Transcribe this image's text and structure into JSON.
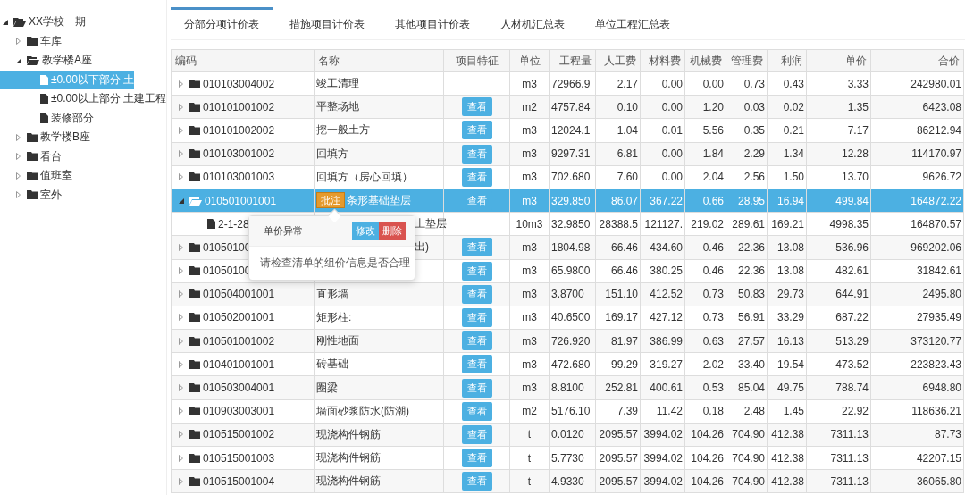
{
  "tree": [
    {
      "label": "XX学校一期",
      "kind": "folder",
      "expanded": true,
      "selected": false,
      "children": [
        {
          "label": "车库",
          "kind": "folder",
          "expanded": false,
          "selected": false
        },
        {
          "label": "教学楼A座",
          "kind": "folder",
          "expanded": true,
          "selected": false,
          "children": [
            {
              "label": "±0.00以下部分 土",
              "kind": "file",
              "selected": true
            },
            {
              "label": "±0.00以上部分 土建工程",
              "kind": "file",
              "selected": false
            },
            {
              "label": "装修部分",
              "kind": "file",
              "selected": false
            }
          ]
        },
        {
          "label": "教学楼B座",
          "kind": "folder",
          "expanded": false,
          "selected": false
        },
        {
          "label": "看台",
          "kind": "folder",
          "expanded": false,
          "selected": false
        },
        {
          "label": "值班室",
          "kind": "folder",
          "expanded": false,
          "selected": false
        },
        {
          "label": "室外",
          "kind": "folder",
          "expanded": false,
          "selected": false
        }
      ]
    }
  ],
  "tabs": [
    {
      "label": "分部分项计价表",
      "selected": true
    },
    {
      "label": "措施项目计价表",
      "selected": false
    },
    {
      "label": "其他项目计价表",
      "selected": false
    },
    {
      "label": "人材机汇总表",
      "selected": false
    },
    {
      "label": "单位工程汇总表",
      "selected": false
    }
  ],
  "table": {
    "columns": [
      "编码",
      "名称",
      "项目特征",
      "单位",
      "工程量",
      "人工费",
      "材料费",
      "机械费",
      "管理费",
      "利润",
      "单价",
      "合价"
    ],
    "rows": [
      {
        "code": "010103004002",
        "kind": "folder",
        "expanded": false,
        "selected": false,
        "name": "竣工清理",
        "unit": "m3",
        "values": [
          "72966.9",
          "2.17",
          "0.00",
          "0.00",
          "0.73",
          "0.43",
          "3.33",
          "242980.01"
        ]
      },
      {
        "code": "010101001002",
        "kind": "folder",
        "expanded": false,
        "selected": false,
        "name": "平整场地",
        "feature": "查看",
        "unit": "m2",
        "values": [
          "4757.84",
          "0.10",
          "0.00",
          "1.20",
          "0.03",
          "0.02",
          "1.35",
          "6423.08"
        ]
      },
      {
        "code": "010101002002",
        "kind": "folder",
        "expanded": false,
        "selected": false,
        "name": "挖一般土方",
        "feature": "查看",
        "unit": "m3",
        "values": [
          "12024.1",
          "1.04",
          "0.01",
          "5.56",
          "0.35",
          "0.21",
          "7.17",
          "86212.94"
        ]
      },
      {
        "code": "010103001002",
        "kind": "folder",
        "expanded": false,
        "selected": false,
        "name": "回填方",
        "feature": "查看",
        "unit": "m3",
        "values": [
          "9297.31",
          "6.81",
          "0.00",
          "1.84",
          "2.29",
          "1.34",
          "12.28",
          "114170.97"
        ]
      },
      {
        "code": "010103001003",
        "kind": "folder",
        "expanded": false,
        "selected": false,
        "name": "回填方（房心回填）",
        "feature": "查看",
        "unit": "m3",
        "values": [
          "702.680",
          "7.60",
          "0.00",
          "2.04",
          "2.56",
          "1.50",
          "13.70",
          "9626.72"
        ]
      },
      {
        "code": "010501001001",
        "kind": "folder",
        "expanded": true,
        "selected": true,
        "note": "批注",
        "name": "条形基础垫层",
        "feature": "查看",
        "unit": "m3",
        "values": [
          "329.850",
          "86.07",
          "367.22",
          "0.66",
          "28.95",
          "16.94",
          "499.84",
          "164872.22"
        ],
        "children": [
          {
            "code": "2-1-28",
            "kind": "file",
            "selected": false,
            "name": "土垫层",
            "unit": "10m3",
            "values": [
              "32.9850",
              "28388.5",
              "121127.",
              "219.02",
              "289.61",
              "169.21",
              "4998.35",
              "164870.57"
            ]
          }
        ]
      },
      {
        "code": "01050100",
        "kind": "folder",
        "expanded": false,
        "selected": false,
        "name": "出)",
        "feature": "查看",
        "unit": "m3",
        "values": [
          "1804.98",
          "66.46",
          "434.60",
          "0.46",
          "22.36",
          "13.08",
          "536.96",
          "969202.06"
        ]
      },
      {
        "code": "01050100",
        "kind": "folder",
        "expanded": false,
        "selected": false,
        "feature": "查看",
        "unit": "m3",
        "values": [
          "65.9800",
          "66.46",
          "380.25",
          "0.46",
          "22.36",
          "13.08",
          "482.61",
          "31842.61"
        ]
      },
      {
        "code": "010504001001",
        "kind": "folder",
        "expanded": false,
        "selected": false,
        "name": "直形墙",
        "feature": "查看",
        "unit": "m3",
        "values": [
          "3.8700",
          "151.10",
          "412.52",
          "0.73",
          "50.83",
          "29.73",
          "644.91",
          "2495.80"
        ]
      },
      {
        "code": "010502001001",
        "kind": "folder",
        "expanded": false,
        "selected": false,
        "name": "矩形柱:",
        "feature": "查看",
        "unit": "m3",
        "values": [
          "40.6500",
          "169.17",
          "427.12",
          "0.73",
          "56.91",
          "33.29",
          "687.22",
          "27935.49"
        ]
      },
      {
        "code": "010501001002",
        "kind": "folder",
        "expanded": false,
        "selected": false,
        "name": "刚性地面",
        "feature": "查看",
        "unit": "m3",
        "values": [
          "726.920",
          "81.97",
          "386.99",
          "0.63",
          "27.57",
          "16.13",
          "513.29",
          "373120.77"
        ]
      },
      {
        "code": "010401001001",
        "kind": "folder",
        "expanded": false,
        "selected": false,
        "name": "砖基础",
        "feature": "查看",
        "unit": "m3",
        "values": [
          "472.680",
          "99.29",
          "319.27",
          "2.02",
          "33.40",
          "19.54",
          "473.52",
          "223823.43"
        ]
      },
      {
        "code": "010503004001",
        "kind": "folder",
        "expanded": false,
        "selected": false,
        "name": "圈梁",
        "feature": "查看",
        "unit": "m3",
        "values": [
          "8.8100",
          "252.81",
          "400.61",
          "0.53",
          "85.04",
          "49.75",
          "788.74",
          "6948.80"
        ]
      },
      {
        "code": "010903003001",
        "kind": "folder",
        "expanded": false,
        "selected": false,
        "name": "墙面砂浆防水(防潮)",
        "feature": "查看",
        "unit": "m2",
        "values": [
          "5176.10",
          "7.39",
          "11.42",
          "0.18",
          "2.48",
          "1.45",
          "22.92",
          "118636.21"
        ]
      },
      {
        "code": "010515001002",
        "kind": "folder",
        "expanded": false,
        "selected": false,
        "name": "现浇构件钢筋",
        "feature": "查看",
        "unit": "t",
        "values": [
          "0.0120",
          "2095.57",
          "3994.02",
          "104.26",
          "704.90",
          "412.38",
          "7311.13",
          "87.73"
        ]
      },
      {
        "code": "010515001003",
        "kind": "folder",
        "expanded": false,
        "selected": false,
        "name": "现浇构件钢筋",
        "feature": "查看",
        "unit": "t",
        "values": [
          "5.7730",
          "2095.57",
          "3994.02",
          "104.26",
          "704.90",
          "412.38",
          "7311.13",
          "42207.15"
        ]
      },
      {
        "code": "010515001004",
        "kind": "folder",
        "expanded": false,
        "selected": false,
        "name": "现浇构件钢筋",
        "feature": "查看",
        "unit": "t",
        "values": [
          "4.9330",
          "2095.57",
          "3994.02",
          "104.26",
          "704.90",
          "412.38",
          "7311.13",
          "36065.80"
        ]
      }
    ]
  },
  "popover": {
    "title": "单价异常",
    "buttons": [
      {
        "label": "修改",
        "kind": "primary"
      },
      {
        "label": "删除",
        "kind": "danger"
      }
    ],
    "message": "请检查清单的组价信息是否合理"
  }
}
